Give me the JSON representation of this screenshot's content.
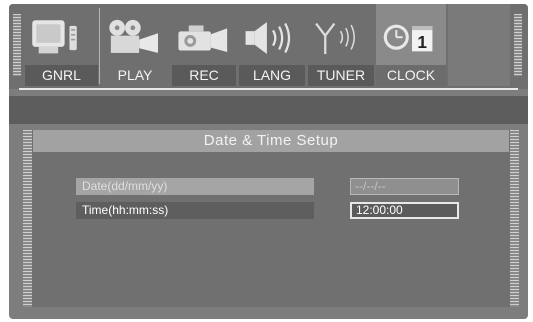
{
  "menu": {
    "tabs": [
      {
        "label": "GNRL",
        "icon": "tv-icon"
      },
      {
        "label": "PLAY",
        "icon": "projector-icon"
      },
      {
        "label": "REC",
        "icon": "camcorder-icon"
      },
      {
        "label": "LANG",
        "icon": "speaker-icon"
      },
      {
        "label": "TUNER",
        "icon": "antenna-icon"
      },
      {
        "label": "CLOCK",
        "icon": "clock-calendar-icon",
        "calendar_day": "1"
      }
    ],
    "selected": "CLOCK"
  },
  "panel": {
    "title": "Date & Time Setup",
    "rows": [
      {
        "label": "Date(dd/mm/yy)",
        "value": "--/--/--",
        "enabled": false
      },
      {
        "label": "Time(hh:mm:ss)",
        "value": "12:00:00",
        "enabled": true
      }
    ]
  }
}
